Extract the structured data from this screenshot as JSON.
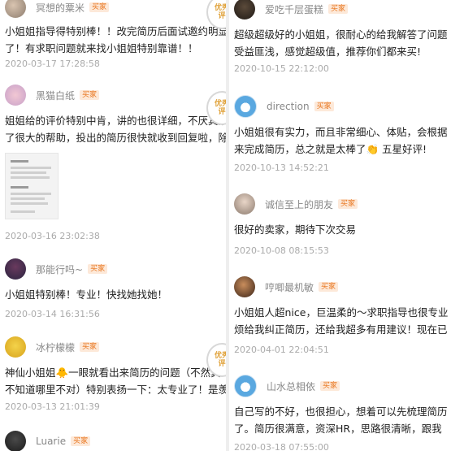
{
  "left": {
    "reviews": [
      {
        "user": "冥想的粟米",
        "badge": "买家",
        "text": [
          "小姐姐指导得特别棒！！改完简历后面试邀约明显",
          "了！有求职问题就来找小姐姐特别靠谱！！"
        ],
        "date": "2020-03-17 17:28:58",
        "stamp": "优秀\n评"
      },
      {
        "user": "黑猫白纸",
        "badge": "买家",
        "text": [
          "姐姐给的评价特别中肯，讲的也很详细，不厌其烦",
          "了很大的帮助，投出的简历很快就收到回复啦，除"
        ],
        "date": "2020-03-16 23:02:38",
        "stamp": "优秀\n评"
      },
      {
        "user": "那能行吗~",
        "badge": "买家",
        "text": [
          "小姐姐特别棒！专业！快找她找她！"
        ],
        "date": "2020-03-14 16:31:56"
      },
      {
        "user": "冰柠檬檬",
        "badge": "买家",
        "text": [
          "神仙小姐姐🐥一眼就看出来简历的问题（不然真的",
          "不知道哪里不对）特别表扬一下：太专业了！是羡"
        ],
        "date": "2020-03-13 21:01:39",
        "stamp": "优秀\n评"
      },
      {
        "user": "Luarie",
        "badge": "买家"
      }
    ]
  },
  "right": {
    "reviews": [
      {
        "user": "爱吃千层蛋糕",
        "badge": "买家",
        "text": [
          "超级超级好的小姐姐，很耐心的给我解答了问题",
          "受益匪浅，感觉超级值，推荐你们都来买!"
        ],
        "date": "2020-10-15 22:12:00"
      },
      {
        "user": "direction",
        "badge": "买家",
        "text": [
          "小姐姐很有实力，而且非常细心、体贴，会根据",
          "来完成简历，总之就是太棒了👏 五星好评!"
        ],
        "date": "2020-10-13 14:52:21"
      },
      {
        "user": "诚信至上的朋友",
        "badge": "买家",
        "text": [
          "很好的卖家，期待下次交易"
        ],
        "date": "2020-10-08 08:15:53"
      },
      {
        "user": "哼唧最机敏",
        "badge": "买家",
        "text": [
          "小姐姐人超nice，巨温柔的～求职指导也很专业",
          "烦给我纠正简历，还给我超多有用建议！现在已"
        ],
        "date": "2020-04-01 22:04:51"
      },
      {
        "user": "山水总相依",
        "badge": "买家",
        "text": [
          "自己写的不好，也很担心，想着可以先梳理简历",
          "了。简历很满意，资深HR，思路很清晰，跟我"
        ],
        "date": "2020-03-18 07:55:00"
      }
    ]
  }
}
